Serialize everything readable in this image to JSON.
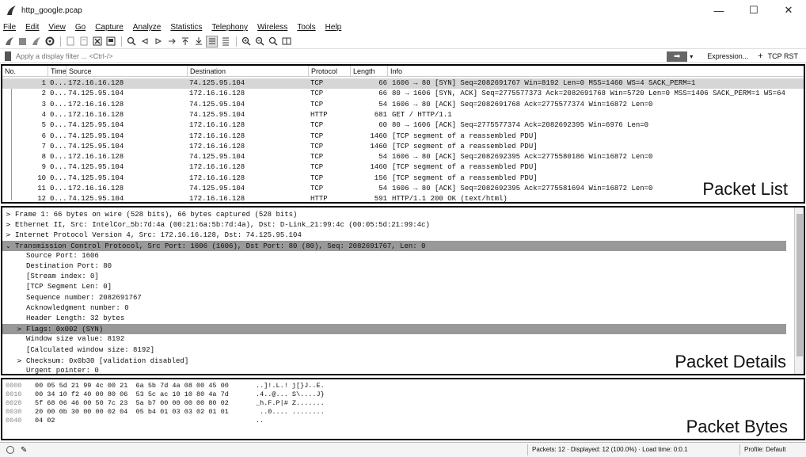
{
  "window": {
    "title": "http_google.pcap",
    "minimize": "—",
    "maximize": "☐",
    "close": "✕"
  },
  "menu": [
    "File",
    "Edit",
    "View",
    "Go",
    "Capture",
    "Analyze",
    "Statistics",
    "Telephony",
    "Wireless",
    "Tools",
    "Help"
  ],
  "filter": {
    "placeholder": "Apply a display filter ... <Ctrl-/>",
    "expression_label": "Expression...",
    "plus": "+",
    "tcp_rst": "TCP RST",
    "apply_arrow": "➡",
    "dropdown": "▾"
  },
  "packet_list": {
    "label": "Packet List",
    "columns": [
      "No.",
      "Time",
      "Source",
      "Destination",
      "Protocol",
      "Length",
      "Info"
    ],
    "rows": [
      {
        "no": "1",
        "time": "0...",
        "src": "172.16.16.128",
        "dst": "74.125.95.104",
        "proto": "TCP",
        "len": "66",
        "info": "1606 → 80 [SYN] Seq=2082691767 Win=8192 Len=0 MSS=1460 WS=4 SACK_PERM=1"
      },
      {
        "no": "2",
        "time": "0...",
        "src": "74.125.95.104",
        "dst": "172.16.16.128",
        "proto": "TCP",
        "len": "66",
        "info": "80 → 1606 [SYN, ACK] Seq=2775577373 Ack=2082691768 Win=5720 Len=0 MSS=1406 SACK_PERM=1 WS=64"
      },
      {
        "no": "3",
        "time": "0...",
        "src": "172.16.16.128",
        "dst": "74.125.95.104",
        "proto": "TCP",
        "len": "54",
        "info": "1606 → 80 [ACK] Seq=2082691768 Ack=2775577374 Win=16872 Len=0"
      },
      {
        "no": "4",
        "time": "0...",
        "src": "172.16.16.128",
        "dst": "74.125.95.104",
        "proto": "HTTP",
        "len": "681",
        "info": "GET / HTTP/1.1"
      },
      {
        "no": "5",
        "time": "0...",
        "src": "74.125.95.104",
        "dst": "172.16.16.128",
        "proto": "TCP",
        "len": "60",
        "info": "80 → 1606 [ACK] Seq=2775577374 Ack=2082692395 Win=6976 Len=0"
      },
      {
        "no": "6",
        "time": "0...",
        "src": "74.125.95.104",
        "dst": "172.16.16.128",
        "proto": "TCP",
        "len": "1460",
        "info": "[TCP segment of a reassembled PDU]"
      },
      {
        "no": "7",
        "time": "0...",
        "src": "74.125.95.104",
        "dst": "172.16.16.128",
        "proto": "TCP",
        "len": "1460",
        "info": "[TCP segment of a reassembled PDU]"
      },
      {
        "no": "8",
        "time": "0...",
        "src": "172.16.16.128",
        "dst": "74.125.95.104",
        "proto": "TCP",
        "len": "54",
        "info": "1606 → 80 [ACK] Seq=2082692395 Ack=2775580186 Win=16872 Len=0"
      },
      {
        "no": "9",
        "time": "0...",
        "src": "74.125.95.104",
        "dst": "172.16.16.128",
        "proto": "TCP",
        "len": "1460",
        "info": "[TCP segment of a reassembled PDU]"
      },
      {
        "no": "10",
        "time": "0...",
        "src": "74.125.95.104",
        "dst": "172.16.16.128",
        "proto": "TCP",
        "len": "156",
        "info": "[TCP segment of a reassembled PDU]"
      },
      {
        "no": "11",
        "time": "0...",
        "src": "172.16.16.128",
        "dst": "74.125.95.104",
        "proto": "TCP",
        "len": "54",
        "info": "1606 → 80 [ACK] Seq=2082692395 Ack=2775581694 Win=16872 Len=0"
      },
      {
        "no": "12",
        "time": "0...",
        "src": "74.125.95.104",
        "dst": "172.16.16.128",
        "proto": "HTTP",
        "len": "591",
        "info": "HTTP/1.1 200 OK  (text/html)"
      }
    ]
  },
  "packet_details": {
    "label": "Packet Details",
    "rows": [
      {
        "arrow": ">",
        "text": "Frame 1: 66 bytes on wire (528 bits), 66 bytes captured (528 bits)",
        "indent": 0
      },
      {
        "arrow": ">",
        "text": "Ethernet II, Src: IntelCor_5b:7d:4a (00:21:6a:5b:7d:4a), Dst: D-Link_21:99:4c (00:05:5d:21:99:4c)",
        "indent": 0
      },
      {
        "arrow": ">",
        "text": "Internet Protocol Version 4, Src: 172.16.16.128, Dst: 74.125.95.104",
        "indent": 0
      },
      {
        "arrow": "⌄",
        "text": "Transmission Control Protocol, Src Port: 1606 (1606), Dst Port: 80 (80), Seq: 2082691767, Len: 0",
        "indent": 0
      },
      {
        "arrow": "",
        "text": "Source Port: 1606",
        "indent": 1
      },
      {
        "arrow": "",
        "text": "Destination Port: 80",
        "indent": 1
      },
      {
        "arrow": "",
        "text": "[Stream index: 0]",
        "indent": 1
      },
      {
        "arrow": "",
        "text": "[TCP Segment Len: 0]",
        "indent": 1
      },
      {
        "arrow": "",
        "text": "Sequence number: 2082691767",
        "indent": 1
      },
      {
        "arrow": "",
        "text": "Acknowledgment number: 0",
        "indent": 1
      },
      {
        "arrow": "",
        "text": "Header Length: 32 bytes",
        "indent": 1
      },
      {
        "arrow": ">",
        "text": "Flags: 0x002 (SYN)",
        "indent": 1
      },
      {
        "arrow": "",
        "text": "Window size value: 8192",
        "indent": 1
      },
      {
        "arrow": "",
        "text": "[Calculated window size: 8192]",
        "indent": 1
      },
      {
        "arrow": ">",
        "text": "Checksum: 0x0b30 [validation disabled]",
        "indent": 1
      },
      {
        "arrow": "",
        "text": "Urgent pointer: 0",
        "indent": 1
      }
    ]
  },
  "packet_bytes": {
    "label": "Packet Bytes",
    "rows": [
      {
        "off": "0000",
        "hex": "00 05 5d 21 99 4c 00 21  6a 5b 7d 4a 08 00 45 00",
        "ascii": "..]!.L.! j[}J..E."
      },
      {
        "off": "0010",
        "hex": "00 34 10 f2 40 00 80 06  53 5c ac 10 10 80 4a 7d",
        "ascii": ".4..@... S\\....J}"
      },
      {
        "off": "0020",
        "hex": "5f 68 06 46 00 50 7c 23  5a b7 00 00 00 00 80 02",
        "ascii": "_h.F.P|# Z......."
      },
      {
        "off": "0030",
        "hex": "20 00 0b 30 00 00 02 04  05 b4 01 03 03 02 01 01",
        "ascii": " ..0.... ........"
      },
      {
        "off": "0040",
        "hex": "04 02",
        "ascii": ".."
      }
    ]
  },
  "status": {
    "packets_text": "Packets: 12 · Displayed: 12 (100.0%) · Load time: 0:0.1",
    "profile_text": "Profile: Default"
  }
}
